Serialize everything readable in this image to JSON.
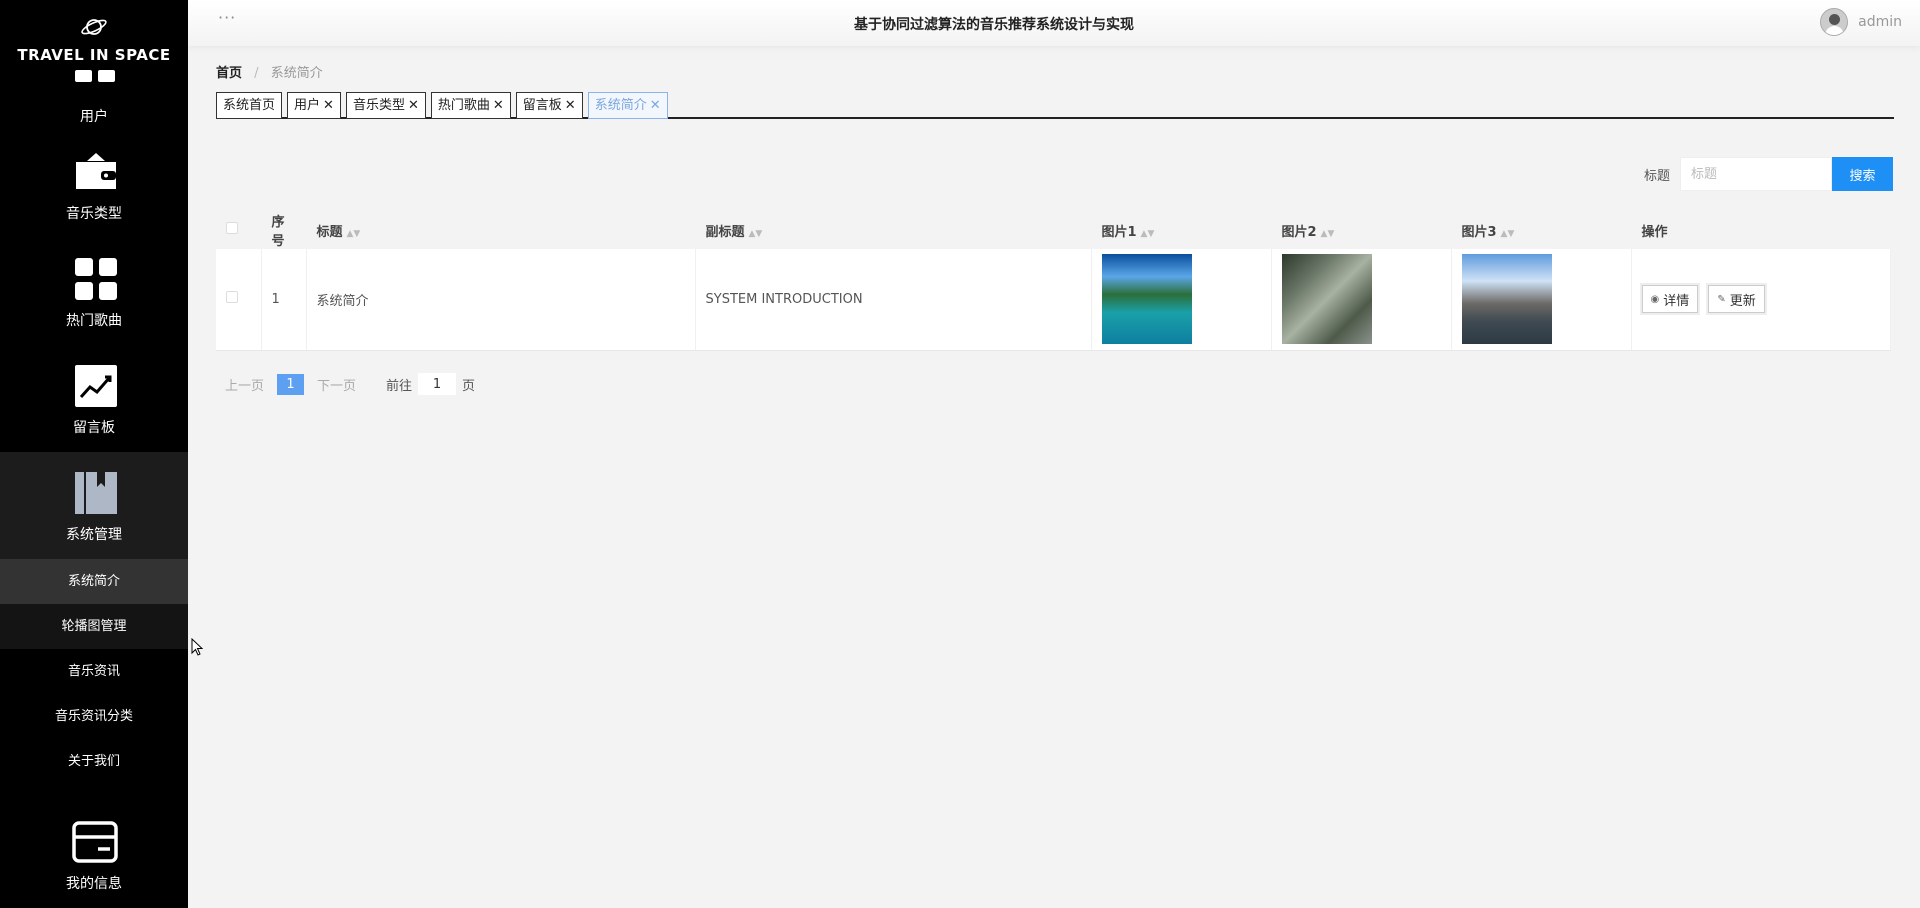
{
  "app": {
    "logo_text": "TRAVEL IN SPACE",
    "title": "基于协同过滤算法的音乐推荐系统设计与实现",
    "username": "admin"
  },
  "sidebar": {
    "items": [
      {
        "label": "用户",
        "icon": "users-icon"
      },
      {
        "label": "音乐类型",
        "icon": "wallet-icon"
      },
      {
        "label": "热门歌曲",
        "icon": "grid-icon"
      },
      {
        "label": "留言板",
        "icon": "chart-icon"
      },
      {
        "label": "系统管理",
        "icon": "book-icon"
      }
    ],
    "submenu": [
      {
        "label": "系统简介"
      },
      {
        "label": "轮播图管理"
      },
      {
        "label": "音乐资讯"
      },
      {
        "label": "音乐资讯分类"
      },
      {
        "label": "关于我们"
      }
    ],
    "bottom": {
      "label": "我的信息",
      "icon": "card-icon"
    }
  },
  "breadcrumb": {
    "home": "首页",
    "separator": "/",
    "current": "系统简介"
  },
  "tags": [
    {
      "label": "系统首页",
      "closable": false
    },
    {
      "label": "用户",
      "closable": true
    },
    {
      "label": "音乐类型",
      "closable": true
    },
    {
      "label": "热门歌曲",
      "closable": true
    },
    {
      "label": "留言板",
      "closable": true
    },
    {
      "label": "系统简介",
      "closable": true
    }
  ],
  "search": {
    "label": "标题",
    "placeholder": "标题",
    "button": "搜索"
  },
  "table": {
    "headers": {
      "index": "序号",
      "title": "标题",
      "subtitle": "副标题",
      "pic1": "图片1",
      "pic2": "图片2",
      "pic3": "图片3",
      "actions": "操作"
    },
    "rows": [
      {
        "index": "1",
        "title": "系统简介",
        "subtitle": "SYSTEM INTRODUCTION"
      }
    ],
    "actions": {
      "detail": "详情",
      "update": "更新"
    }
  },
  "pager": {
    "prev": "上一页",
    "current": "1",
    "next": "下一页",
    "goto_prefix": "前往",
    "goto_value": "1",
    "goto_suffix": "页"
  },
  "colors": {
    "sidebar_bg": "#000000",
    "accent": "#1e90f5",
    "page_bg": "#f3f3f3"
  }
}
